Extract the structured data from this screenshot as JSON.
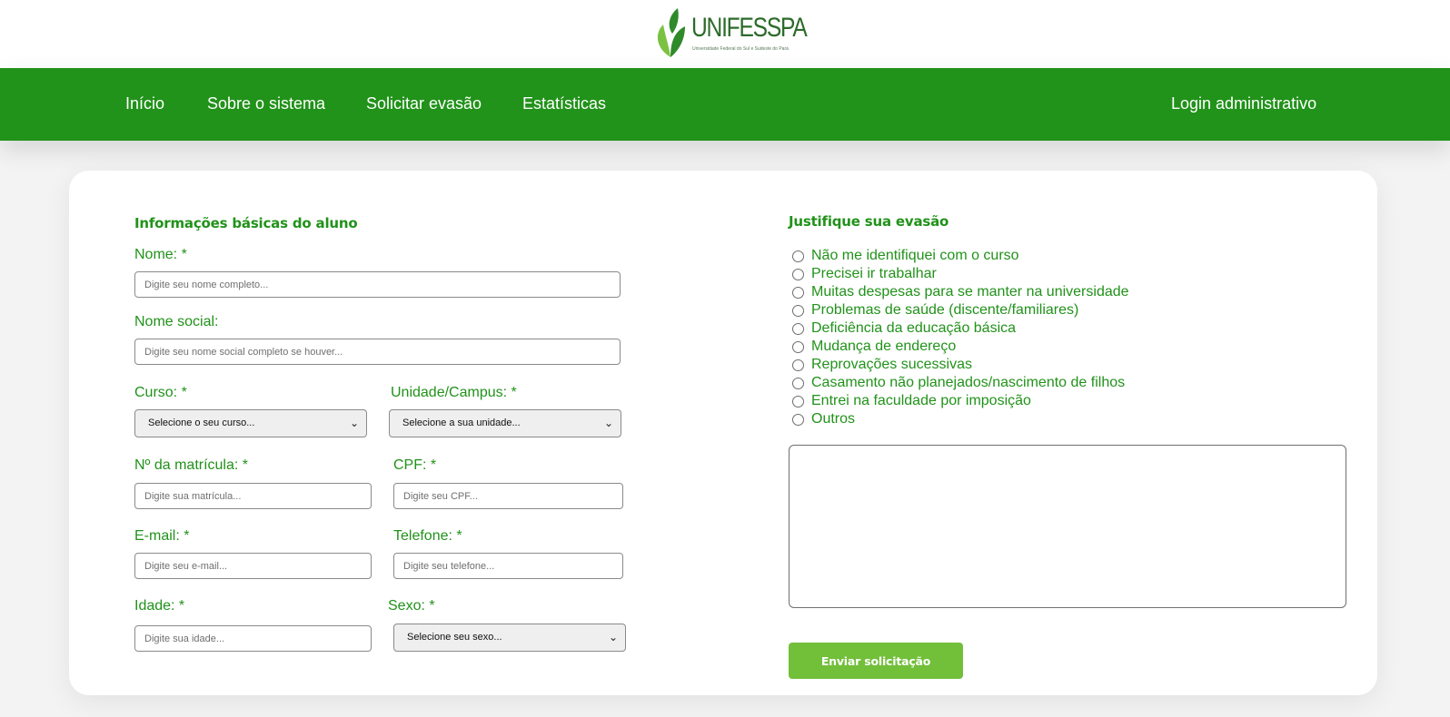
{
  "header": {
    "logo_text": "UNIFESSPA",
    "logo_subtitle": "Universidade Federal do Sul e Sudeste do Pará"
  },
  "nav": {
    "inicio": "Início",
    "sobre": "Sobre o sistema",
    "solicitar": "Solicitar evasão",
    "estatisticas": "Estatísticas",
    "login": "Login administrativo"
  },
  "student_info": {
    "title": "Informações básicas do aluno",
    "nome": {
      "label": "Nome: *",
      "placeholder": "Digite seu nome completo..."
    },
    "nome_social": {
      "label": "Nome social:",
      "placeholder": "Digite seu nome social completo se houver..."
    },
    "curso": {
      "label": "Curso: *",
      "selected": "Selecione o seu curso..."
    },
    "unidade": {
      "label": "Unidade/Campus: *",
      "selected": "Selecione a sua unidade..."
    },
    "matricula": {
      "label": "Nº da matrícula: *",
      "placeholder": "Digite sua matrícula..."
    },
    "cpf": {
      "label": "CPF: *",
      "placeholder": "Digite seu CPF..."
    },
    "email": {
      "label": "E-mail: *",
      "placeholder": "Digite seu e-mail..."
    },
    "telefone": {
      "label": "Telefone: *",
      "placeholder": "Digite seu telefone..."
    },
    "idade": {
      "label": "Idade: *",
      "placeholder": "Digite sua idade..."
    },
    "sexo": {
      "label": "Sexo: *",
      "selected": "Selecione seu sexo..."
    }
  },
  "justification": {
    "title": "Justifique sua evasão",
    "options": [
      "Não me identifiquei com o curso",
      "Precisei ir trabalhar",
      "Muitas despesas para se manter na universidade",
      "Problemas de saúde (discente/familiares)",
      "Deficiência da educação básica",
      "Mudança de endereço",
      "Reprovações sucessivas",
      "Casamento não planejados/nascimento de filhos",
      "Entrei na faculdade por imposição",
      "Outros"
    ],
    "textarea_value": ""
  },
  "submit_label": "Enviar solicitação",
  "colors": {
    "primary_green": "#21921a",
    "button_green": "#72bf3a",
    "logo_leaf_light": "#7cc242",
    "logo_leaf_dark": "#2f8a2a"
  }
}
